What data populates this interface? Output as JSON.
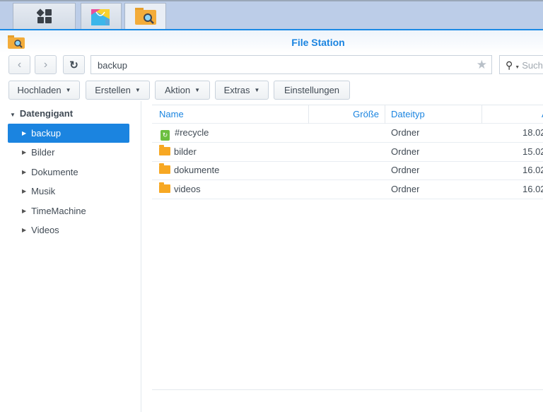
{
  "taskbar": {
    "items": [
      {
        "name": "main-menu"
      },
      {
        "name": "package-center"
      },
      {
        "name": "file-station"
      }
    ]
  },
  "window": {
    "title": "File Station"
  },
  "nav": {
    "path": "backup",
    "search_placeholder": "Such"
  },
  "toolbar": {
    "upload": "Hochladen",
    "create": "Erstellen",
    "action": "Aktion",
    "extras": "Extras",
    "settings": "Einstellungen"
  },
  "sidebar": {
    "root": "Datengigant",
    "items": [
      "backup",
      "Bilder",
      "Dokumente",
      "Musik",
      "TimeMachine",
      "Videos"
    ],
    "selected": "backup"
  },
  "table": {
    "columns": [
      "Name",
      "Größe",
      "Dateityp",
      "Ä"
    ],
    "rows": [
      {
        "name": "#recycle",
        "size": "",
        "type": "Ordner",
        "date": "18.02"
      },
      {
        "name": "bilder",
        "size": "",
        "type": "Ordner",
        "date": "15.02"
      },
      {
        "name": "dokumente",
        "size": "",
        "type": "Ordner",
        "date": "16.02"
      },
      {
        "name": "videos",
        "size": "",
        "type": "Ordner",
        "date": "16.02"
      }
    ]
  },
  "colors": {
    "accent": "#1b84e0",
    "folder": "#f7a823",
    "recycle": "#6cbf3f"
  }
}
